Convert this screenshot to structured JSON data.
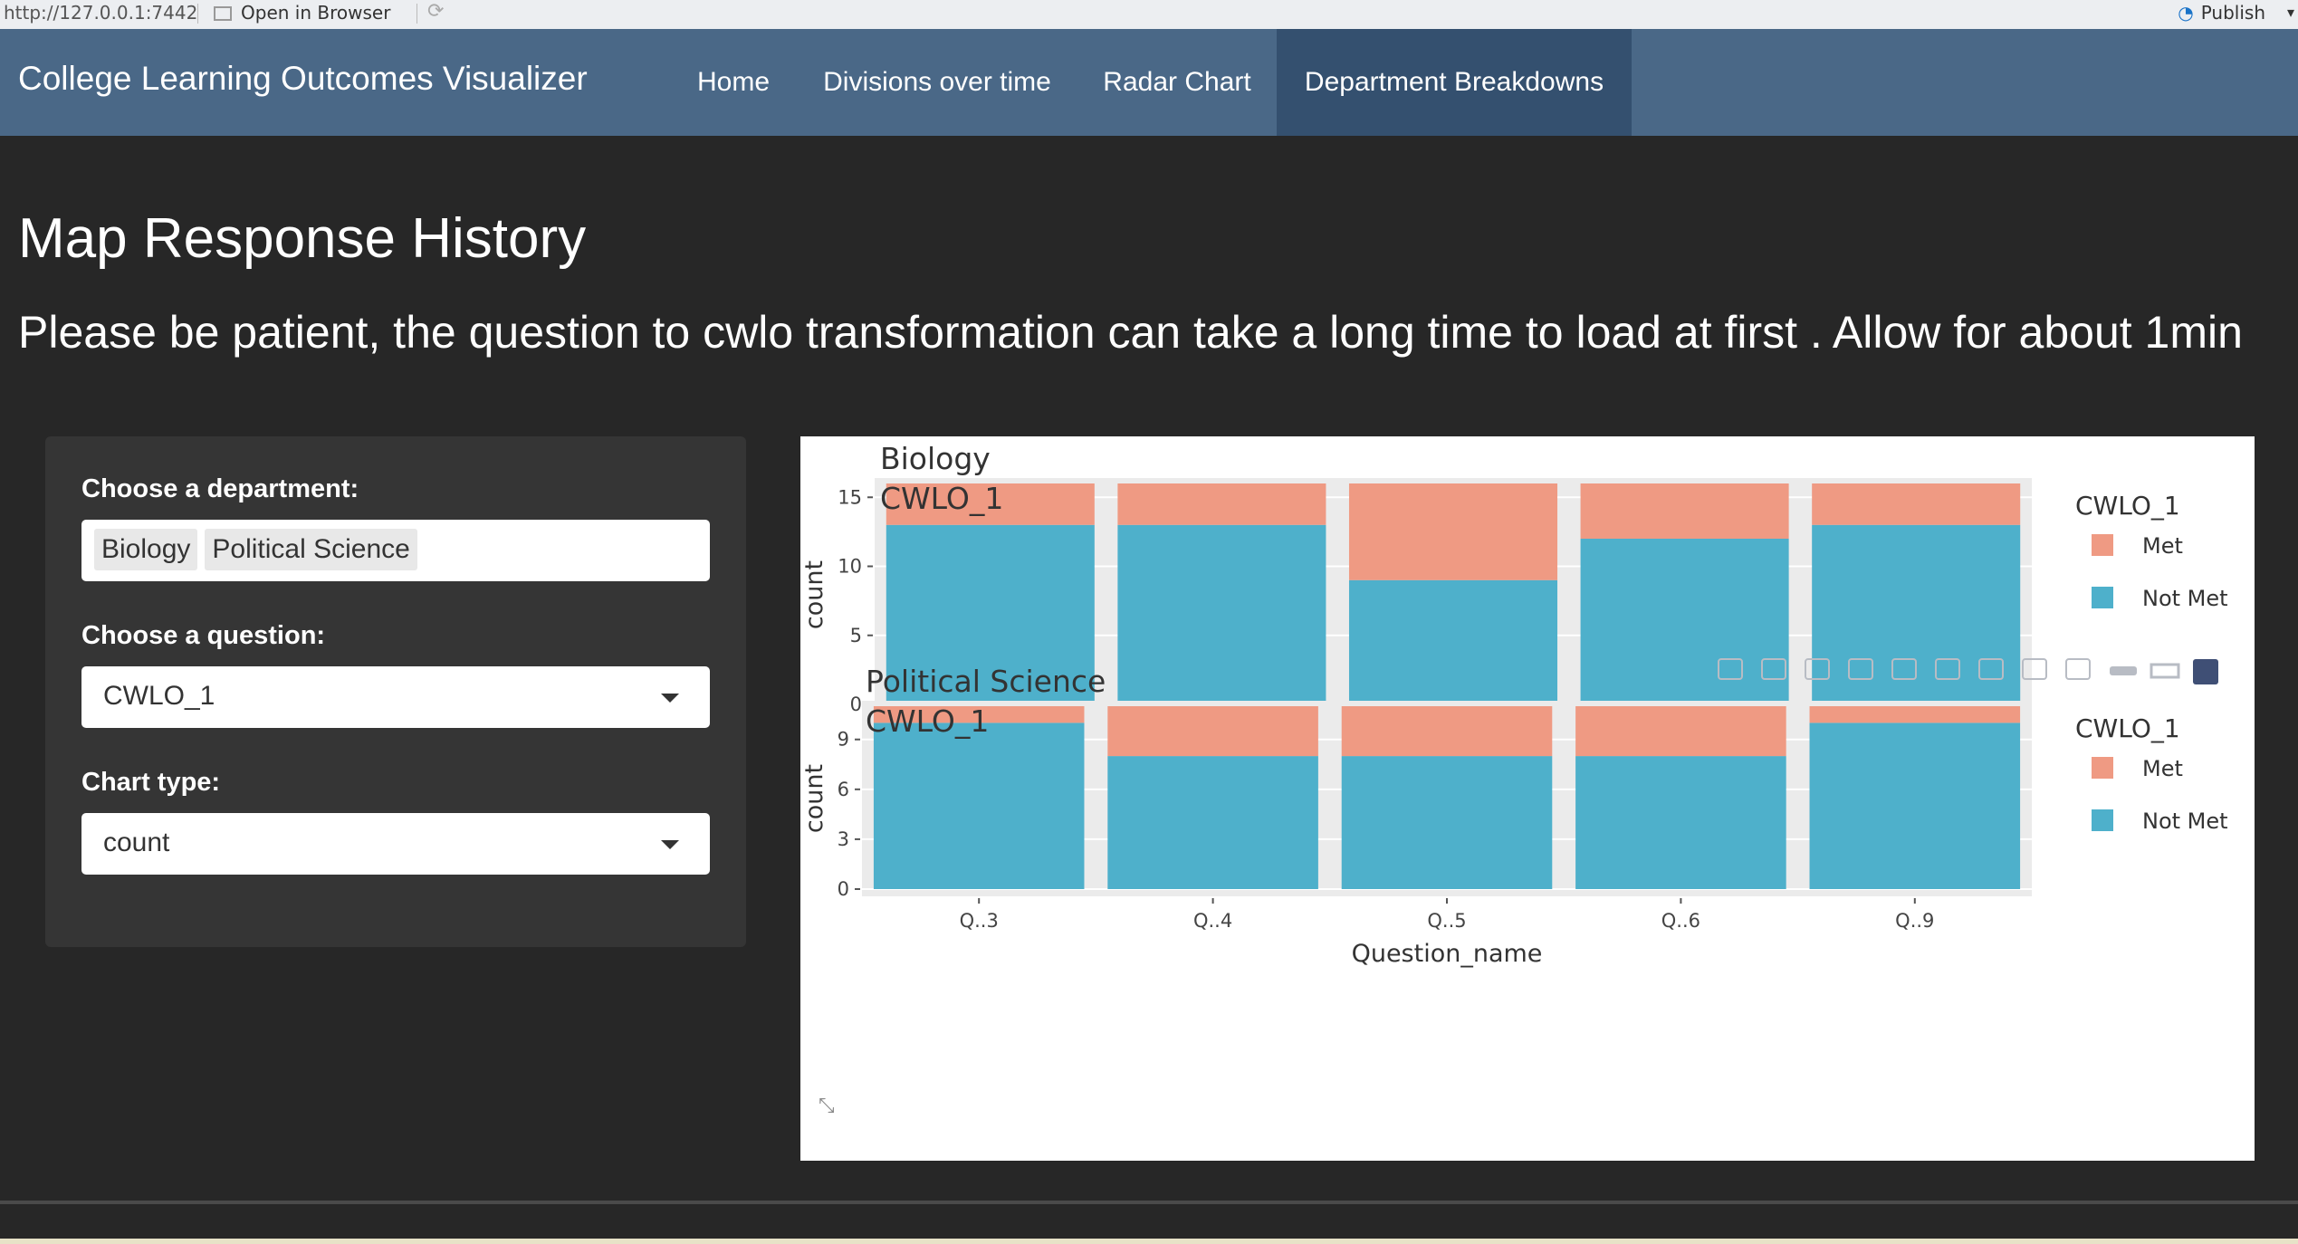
{
  "browser": {
    "url": "http://127.0.0.1:7442",
    "open_in_browser": "Open in Browser",
    "publish": "Publish"
  },
  "navbar": {
    "brand": "College Learning Outcomes Visualizer",
    "items": [
      {
        "label": "Home",
        "active": false
      },
      {
        "label": "Divisions over time",
        "active": false
      },
      {
        "label": "Radar Chart",
        "active": false
      },
      {
        "label": "Department Breakdowns",
        "active": true
      }
    ]
  },
  "page": {
    "title": "Map Response History",
    "notice": "Please be patient, the question to cwlo transformation can take a long time to load at first . Allow for about 1min"
  },
  "sidebar": {
    "department": {
      "label": "Choose a department:",
      "selected": [
        "Biology",
        "Political Science"
      ]
    },
    "question": {
      "label": "Choose a question:",
      "value": "CWLO_1"
    },
    "chart_type": {
      "label": "Chart type:",
      "value": "count"
    }
  },
  "colors": {
    "met": "#ef9a83",
    "not_met": "#4eb0cb",
    "panel_bg": "#ebebeb"
  },
  "modebar_icons": [
    "camera-icon",
    "zoom-icon",
    "pan-icon",
    "box-select-icon",
    "lasso-icon",
    "zoom-in-icon",
    "zoom-out-icon",
    "autoscale-icon",
    "reset-axes-icon",
    "spike-lines-icon",
    "hover-closest-icon",
    "hover-compare-icon",
    "plotly-logo-icon"
  ],
  "chart_data": [
    {
      "type": "bar",
      "stacked": true,
      "title": "Biology\nCWLO_1",
      "title_lines": [
        "Biology",
        "CWLO_1"
      ],
      "xlabel": "Question_name",
      "ylabel": "count",
      "categories": [
        "Q..3",
        "Q..4",
        "Q..5",
        "Q..6",
        "Q..9"
      ],
      "series": [
        {
          "name": "Not Met",
          "values": [
            13,
            13,
            9,
            12,
            13
          ]
        },
        {
          "name": "Met",
          "values": [
            3,
            3,
            7,
            4,
            3
          ]
        }
      ],
      "ylim": [
        0,
        16
      ],
      "yticks": [
        0,
        5,
        10,
        15
      ],
      "legend": {
        "title": "CWLO_1",
        "entries": [
          "Met",
          "Not Met"
        ],
        "placement": "right"
      }
    },
    {
      "type": "bar",
      "stacked": true,
      "title": "Political Science\nCWLO_1",
      "title_lines": [
        "Political Science",
        "CWLO_1"
      ],
      "xlabel": "Question_name",
      "ylabel": "count",
      "categories": [
        "Q..3",
        "Q..4",
        "Q..5",
        "Q..6",
        "Q..9"
      ],
      "series": [
        {
          "name": "Not Met",
          "values": [
            10,
            8,
            8,
            8,
            10
          ]
        },
        {
          "name": "Met",
          "values": [
            1,
            3,
            3,
            3,
            1
          ]
        }
      ],
      "ylim": [
        0,
        11
      ],
      "yticks": [
        0,
        3,
        6,
        9
      ],
      "legend": {
        "title": "CWLO_1",
        "entries": [
          "Met",
          "Not Met"
        ],
        "placement": "right"
      }
    }
  ]
}
